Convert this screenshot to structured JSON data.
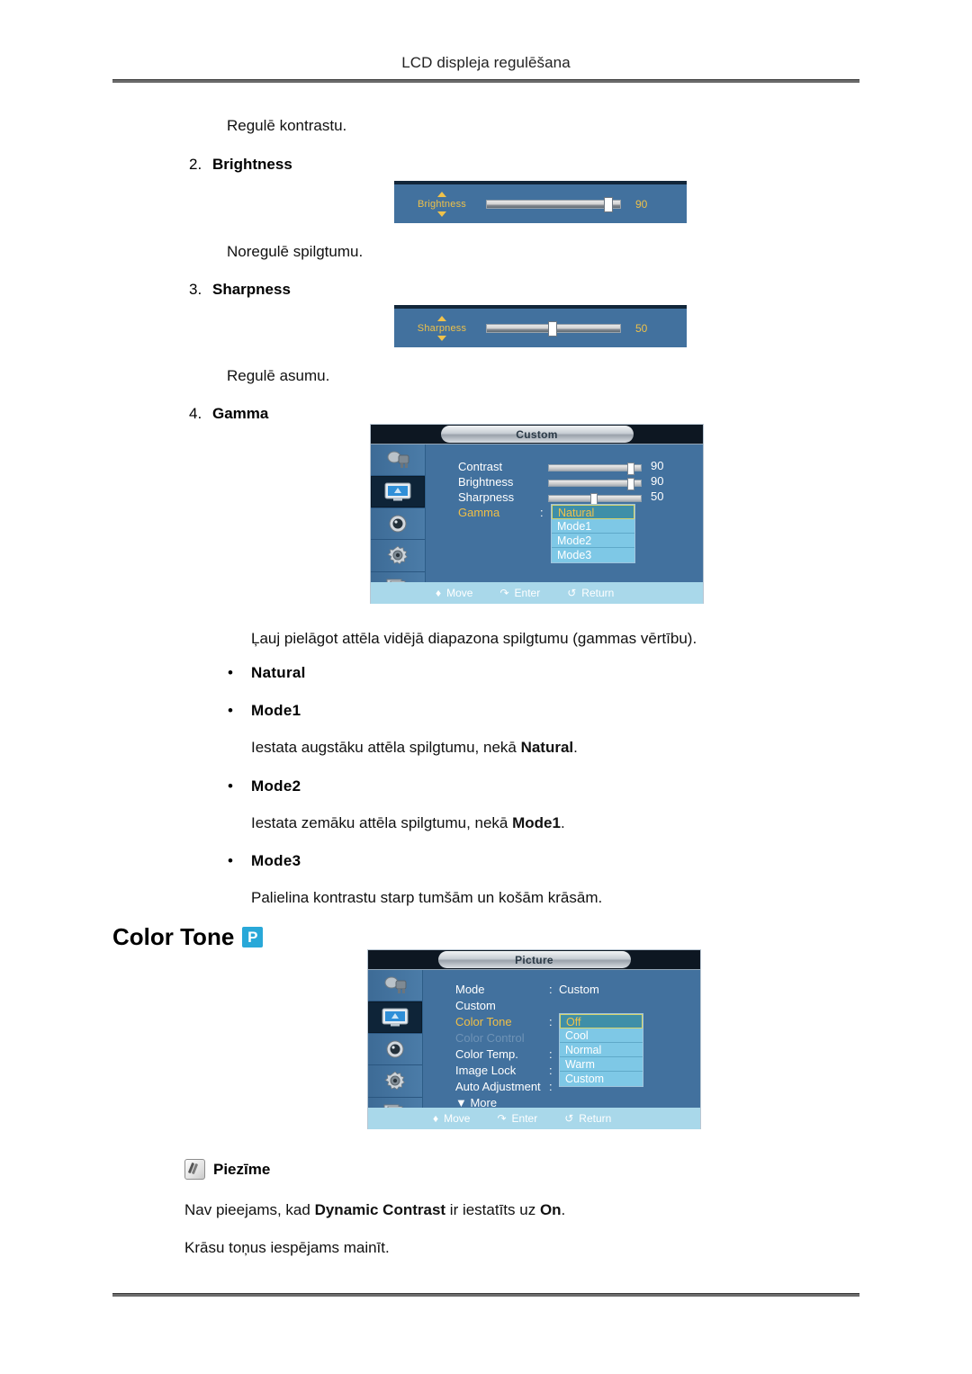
{
  "page": {
    "running_head": "LCD displeja regulēšana"
  },
  "sections": [
    {
      "text": "Regulē kontrastu."
    },
    {
      "number": "2.",
      "label": "Brightness"
    },
    {
      "text": "Noregulē spilgtumu."
    },
    {
      "number": "3.",
      "label": "Sharpness"
    },
    {
      "text": "Regulē asumu."
    },
    {
      "number": "4.",
      "label": "Gamma"
    }
  ],
  "brightness_widget": {
    "name": "Brightness",
    "value": "90",
    "percent": 90
  },
  "sharpness_widget": {
    "name": "Sharpness",
    "value": "50",
    "percent": 50
  },
  "gamma_menu": {
    "title": "Custom",
    "rows": [
      {
        "label": "Contrast",
        "value": "90",
        "percent": 90
      },
      {
        "label": "Brightness",
        "value": "90",
        "percent": 90
      },
      {
        "label": "Sharpness",
        "value": "50",
        "percent": 50
      }
    ],
    "gamma_label": "Gamma",
    "colon": ":",
    "options": [
      "Natural",
      "Mode1",
      "Mode2",
      "Mode3"
    ],
    "selected_option": "Natural",
    "footer": [
      {
        "icon": "move-icon",
        "label": "Move"
      },
      {
        "icon": "enter-icon",
        "label": "Enter"
      },
      {
        "icon": "return-icon",
        "label": "Return"
      }
    ],
    "sidebar_icons": [
      "input-source-icon",
      "picture-icon",
      "sound-icon",
      "setup-icon",
      "multi-control-icon"
    ],
    "selected_sidebar_index": 1
  },
  "gamma_text": {
    "intro": "Ļauj pielāgot attēla vidējā diapazona spilgtumu (gammas vērtību).",
    "items": [
      {
        "bullet": "•",
        "label": "Natural",
        "desc_before": "",
        "desc_bold": "",
        "desc_after": ""
      },
      {
        "bullet": "•",
        "label": "Mode1",
        "desc_before": "Iestata augstāku attēla spilgtumu, nekā ",
        "desc_bold": "Natural",
        "desc_after": "."
      },
      {
        "bullet": "•",
        "label": "Mode2",
        "desc_before": "Iestata zemāku attēla spilgtumu, nekā ",
        "desc_bold": "Mode1",
        "desc_after": "."
      },
      {
        "bullet": "•",
        "label": "Mode3",
        "desc_before": "Palielina kontrastu starp tumšām un košām krāsām.",
        "desc_bold": "",
        "desc_after": ""
      }
    ]
  },
  "color_tone_heading": {
    "title": "Color Tone",
    "badge": "P",
    "badge_color": "#29a8d8"
  },
  "picture_menu": {
    "title": "Picture",
    "rows": [
      {
        "label": "Mode",
        "colon": ":",
        "value": "Custom",
        "state": "normal"
      },
      {
        "label": "Custom",
        "colon": "",
        "value": "",
        "state": "normal"
      },
      {
        "label": "Color Tone",
        "colon": ":",
        "value": "",
        "state": "highlight"
      },
      {
        "label": "Color Control",
        "colon": "",
        "value": "",
        "state": "disabled"
      },
      {
        "label": "Color Temp.",
        "colon": ":",
        "value": "",
        "state": "normal"
      },
      {
        "label": "Image Lock",
        "colon": ":",
        "value": "",
        "state": "normal"
      },
      {
        "label": "Auto Adjustment",
        "colon": ":",
        "value": "",
        "state": "normal"
      }
    ],
    "more_label": "▼ More",
    "options": [
      "Off",
      "Cool",
      "Normal",
      "Warm",
      "Custom"
    ],
    "selected_option": "Off",
    "footer": [
      {
        "icon": "move-icon",
        "label": "Move"
      },
      {
        "icon": "enter-icon",
        "label": "Enter"
      },
      {
        "icon": "return-icon",
        "label": "Return"
      }
    ],
    "sidebar_icons": [
      "input-source-icon",
      "picture-icon",
      "sound-icon",
      "setup-icon",
      "multi-control-icon"
    ],
    "selected_sidebar_index": 1
  },
  "note": {
    "icon": "note-icon",
    "title": "Piezīme",
    "line1_before": "Nav pieejams, kad ",
    "line1_bold": "Dynamic Contrast",
    "line1_mid": " ir iestatīts uz ",
    "line1_bold2": "On",
    "line1_after": ".",
    "line2": "Krāsu toņus iespējams mainīt."
  },
  "colors": {
    "osd_blue": "#42719e",
    "osd_gold": "#f0c24b",
    "osd_light_blue": "#7ec8e6",
    "osd_footer": "#a9d8ea",
    "badge": "#29a8d8"
  }
}
